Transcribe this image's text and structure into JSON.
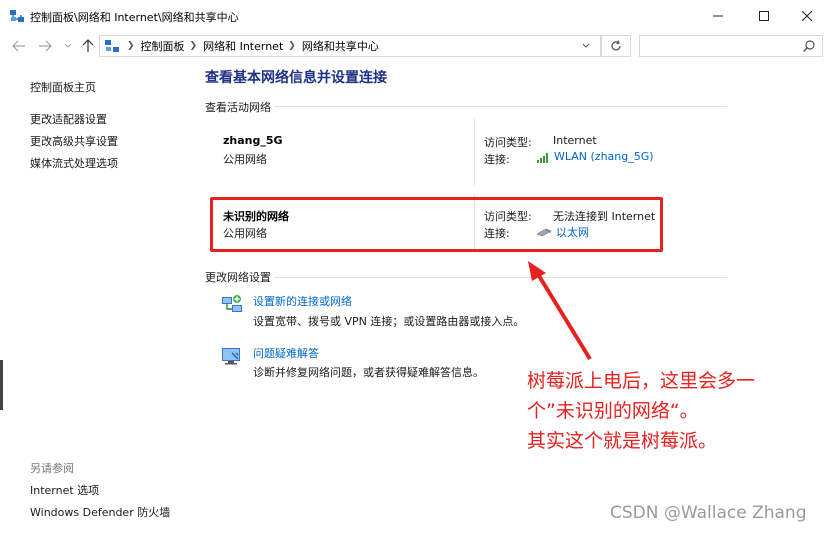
{
  "window": {
    "title": "控制面板\\网络和 Internet\\网络和共享中心",
    "app_icon": "network-sharing-center-icon",
    "buttons": [
      "minimize-icon",
      "maximize-icon",
      "close-icon"
    ]
  },
  "address": {
    "crumbs": [
      "控制面板",
      "网络和 Internet",
      "网络和共享中心"
    ],
    "search_placeholder": ""
  },
  "sidebar": {
    "home": "控制面板主页",
    "links": [
      "更改适配器设置",
      "更改高级共享设置",
      "媒体流式处理选项"
    ],
    "see_also_label": "另请参阅",
    "see_also": [
      "Internet 选项",
      "Windows Defender 防火墙"
    ]
  },
  "main": {
    "title": "查看基本网络信息并设置连接",
    "active_section": "查看活动网络",
    "networks": [
      {
        "name": "zhang_5G",
        "type": "公用网络",
        "access_label": "访问类型:",
        "access_value": "Internet",
        "conn_label": "连接:",
        "conn_value": "WLAN (zhang_5G)",
        "conn_icon": "wifi-signal-icon"
      },
      {
        "name": "未识别的网络",
        "type": "公用网络",
        "access_label": "访问类型:",
        "access_value": "无法连接到 Internet",
        "conn_label": "连接:",
        "conn_value": "以太网",
        "conn_icon": "ethernet-icon"
      }
    ],
    "change_section": "更改网络设置",
    "tasks": [
      {
        "link": "设置新的连接或网络",
        "desc": "设置宽带、拨号或 VPN 连接；或设置路由器或接入点。",
        "icon": "new-connection-icon"
      },
      {
        "link": "问题疑难解答",
        "desc": "诊断并修复网络问题，或者获得疑难解答信息。",
        "icon": "troubleshoot-icon"
      }
    ]
  },
  "annotation": {
    "lines": [
      "树莓派上电后，这里会多一",
      "个”未识别的网络“。",
      "其实这个就是树莓派。"
    ],
    "color": "#e8201f"
  },
  "watermark": "CSDN @Wallace Zhang",
  "colors": {
    "link": "#0066cc",
    "title": "#1e3287",
    "highlight": "#e8201f"
  }
}
